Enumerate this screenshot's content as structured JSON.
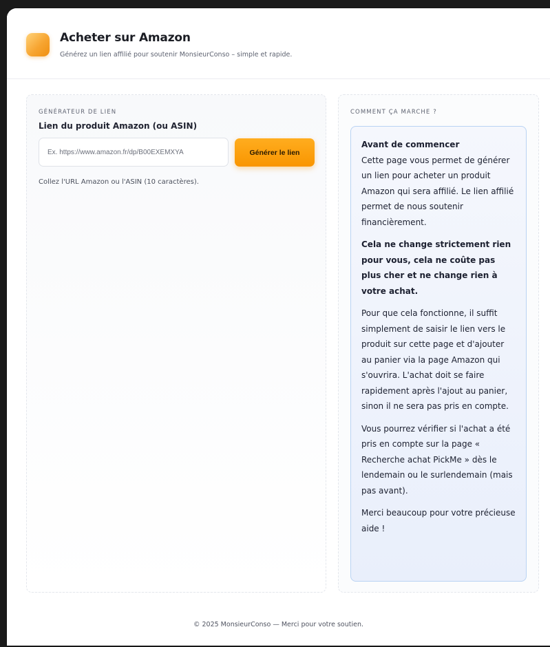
{
  "header": {
    "title": "Acheter sur Amazon",
    "subtitle": "Générez un lien affilié pour soutenir MonsieurConso – simple et rapide."
  },
  "generator": {
    "section_label": "Générateur de lien",
    "field_label": "Lien du produit Amazon (ou ASIN)",
    "input_value": "",
    "input_placeholder": "Ex. https://www.amazon.fr/dp/B00EXEMXYA",
    "button_label": "Générer le lien",
    "hint": "Collez l'URL Amazon ou l'ASIN (10 caractères)."
  },
  "how_it_works": {
    "section_label": "Comment ça marche ?",
    "heading": "Avant de commencer",
    "paragraph_1": "Cette page vous permet de générer un lien pour acheter un produit Amazon qui sera affilié. Le lien affilié permet de nous soutenir financièrement.",
    "paragraph_2": "Cela ne change strictement rien pour vous, cela ne coûte pas plus cher et ne change rien à votre achat.",
    "paragraph_3": "Pour que cela fonctionne, il suffit simplement de saisir le lien vers le produit sur cette page et d'ajouter au panier via la page Amazon qui s'ouvrira. L'achat doit se faire rapidement après l'ajout au panier, sinon il ne sera pas pris en compte.",
    "paragraph_4": "Vous pourrez vérifier si l'achat a été pris en compte sur la page « Recherche achat PickMe » dès le lendemain ou le surlendemain (mais pas avant).",
    "paragraph_5": "Merci beaucoup pour votre précieuse aide !"
  },
  "footer": {
    "text": "© 2025 MonsieurConso — Merci pour votre soutien."
  },
  "colors": {
    "accent": "#f99500",
    "info_border": "#b9d3f3",
    "info_background": "#eef2fb"
  },
  "icons": {
    "logo": "amazon-logo-icon"
  }
}
